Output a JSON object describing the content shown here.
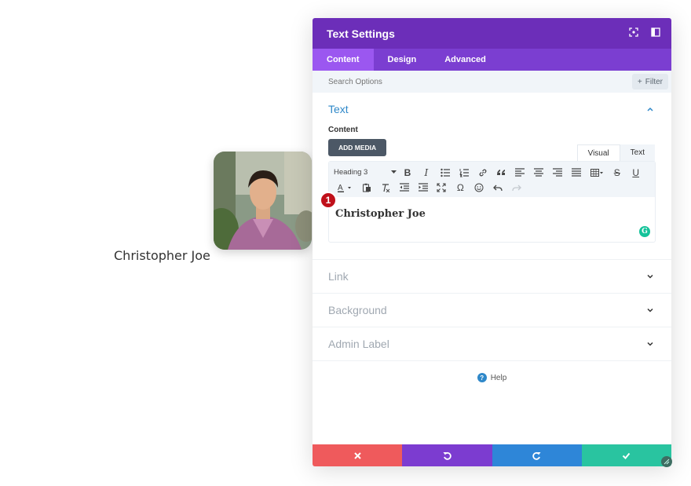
{
  "preview": {
    "name": "Christopher Joe"
  },
  "panel": {
    "title": "Text Settings",
    "tabs": [
      {
        "label": "Content",
        "active": true
      },
      {
        "label": "Design",
        "active": false
      },
      {
        "label": "Advanced",
        "active": false
      }
    ],
    "search": {
      "placeholder": "Search Options",
      "filter_label": "Filter"
    },
    "sections": {
      "text": {
        "title": "Text",
        "content_label": "Content",
        "add_media_label": "ADD MEDIA",
        "editor_tabs": [
          {
            "label": "Visual",
            "active": true
          },
          {
            "label": "Text",
            "active": false
          }
        ],
        "format_select": "Heading 3",
        "editor_content": "Christopher Joe"
      },
      "link": {
        "title": "Link"
      },
      "background": {
        "title": "Background"
      },
      "admin_label": {
        "title": "Admin Label"
      }
    },
    "help_label": "Help",
    "marker_label": "1",
    "grammarly_label": "G"
  },
  "colors": {
    "header": "#6c2eb9",
    "tabs": "#7b3ed1",
    "active_tab": "#9b57f0",
    "accent_blue": "#2f88c9",
    "footer_cancel": "#ef5a5c",
    "footer_undo": "#7c3cd0",
    "footer_redo": "#2e86d8",
    "footer_save": "#29c4a0"
  }
}
